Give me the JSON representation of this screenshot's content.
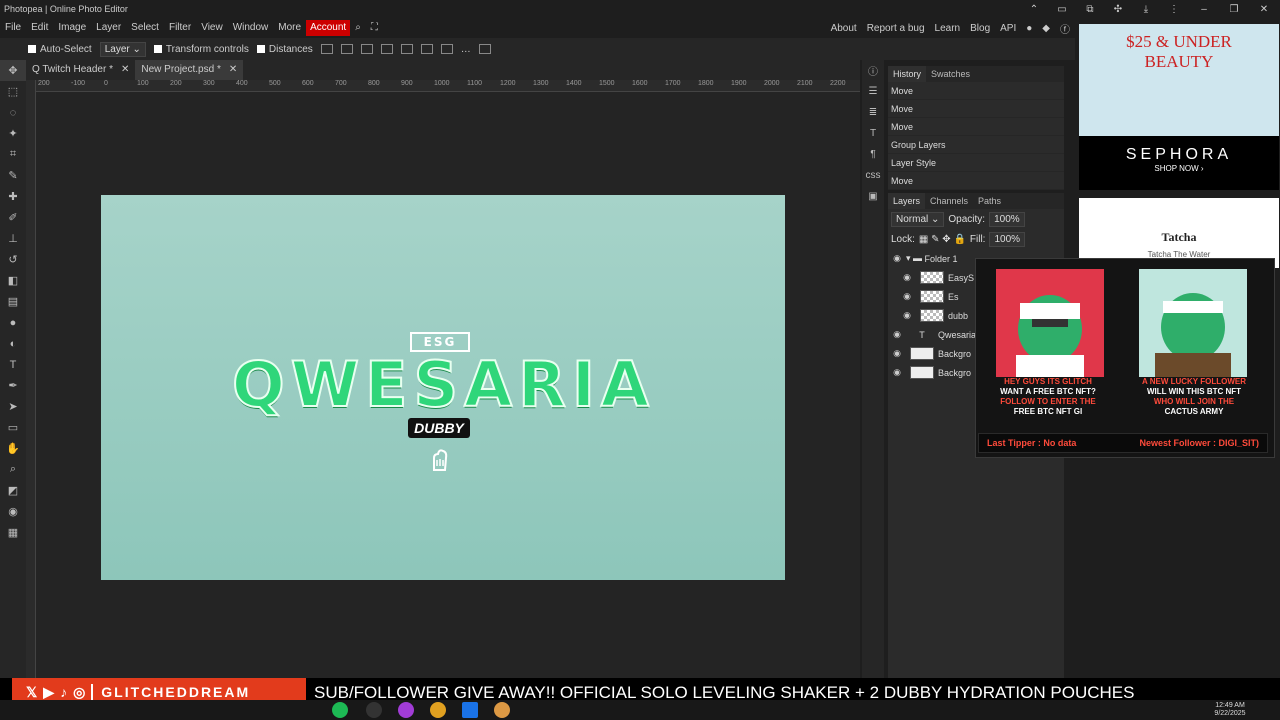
{
  "window": {
    "title": "Photopea | Online Photo Editor"
  },
  "menu": {
    "items": [
      "File",
      "Edit",
      "Image",
      "Layer",
      "Select",
      "Filter",
      "View",
      "Window",
      "More"
    ],
    "account": "Account",
    "links": [
      "About",
      "Report a bug",
      "Learn",
      "Blog",
      "API"
    ]
  },
  "options": {
    "auto_select": "Auto-Select",
    "target": "Layer",
    "transform_controls": "Transform controls",
    "distances": "Distances"
  },
  "tabs": [
    {
      "label": "Q Twitch Header *"
    },
    {
      "label": "New Project.psd *"
    }
  ],
  "ruler": {
    "ticks": [
      "200",
      "-100",
      "0",
      "100",
      "200",
      "300",
      "400",
      "500",
      "600",
      "700",
      "800",
      "900",
      "1000",
      "1100",
      "1200",
      "1300",
      "1400",
      "1500",
      "1600",
      "1700",
      "1800",
      "1900",
      "2000",
      "2100",
      "2200"
    ]
  },
  "canvas": {
    "logo_text": "ESG",
    "title": "QWESARIA",
    "subtitle": "DUBBY"
  },
  "history": {
    "tabs": [
      "History",
      "Swatches"
    ],
    "rows": [
      "Move",
      "Move",
      "Move",
      "Group Layers",
      "Layer Style",
      "Move"
    ]
  },
  "layers": {
    "tabs": [
      "Layers",
      "Channels",
      "Paths"
    ],
    "blend_mode": "Normal",
    "opacity_label": "Opacity:",
    "opacity": "100%",
    "lock_label": "Lock:",
    "fill_label": "Fill:",
    "fill": "100%",
    "rows": [
      {
        "name": "Folder 1",
        "type": "folder"
      },
      {
        "name": "EasyS",
        "type": "raster"
      },
      {
        "name": "Es",
        "type": "raster"
      },
      {
        "name": "dubb",
        "type": "raster"
      },
      {
        "name": "Qwesaria",
        "type": "text"
      },
      {
        "name": "Backgro",
        "type": "solid"
      },
      {
        "name": "Backgro",
        "type": "solid"
      }
    ]
  },
  "ads": {
    "sephora": {
      "headline_1": "$25 & UNDER",
      "headline_2": "BEAUTY",
      "brand": "SEPHORA",
      "cta": "SHOP NOW ›"
    },
    "tatcha": {
      "brand": "Tatcha",
      "tag": "Tatcha The Water"
    }
  },
  "overlay": {
    "card_left": [
      "HEY GUYS ITS GLITCH",
      "WANT A FREE BTC NFT?",
      "FOLLOW TO ENTER THE",
      "FREE BTC NFT GI"
    ],
    "card_right": [
      "A NEW LUCKY FOLLOWER",
      "WILL WIN THIS BTC NFT",
      "WHO WILL JOIN THE",
      "CACTUS ARMY"
    ],
    "last_tipper": "Last Tipper : No data",
    "newest_follower": "Newest Follower : DIGI_SIT)"
  },
  "stream_bar": {
    "brand": "GLITCHEDDREAM",
    "ticker": "SUB/FOLLOWER GIVE AWAY!! OFFICIAL SOLO LEVELING SHAKER + 2 DUBBY HYDRATION POUCHES"
  },
  "taskbar": {
    "time": "12:49 AM",
    "date": "9/22/2025"
  },
  "colors": {
    "accent_red": "#c00000",
    "canvas_bg": "#a6d3c9",
    "title_green": "#2fd67a",
    "ticker_red": "#e23b1c"
  }
}
